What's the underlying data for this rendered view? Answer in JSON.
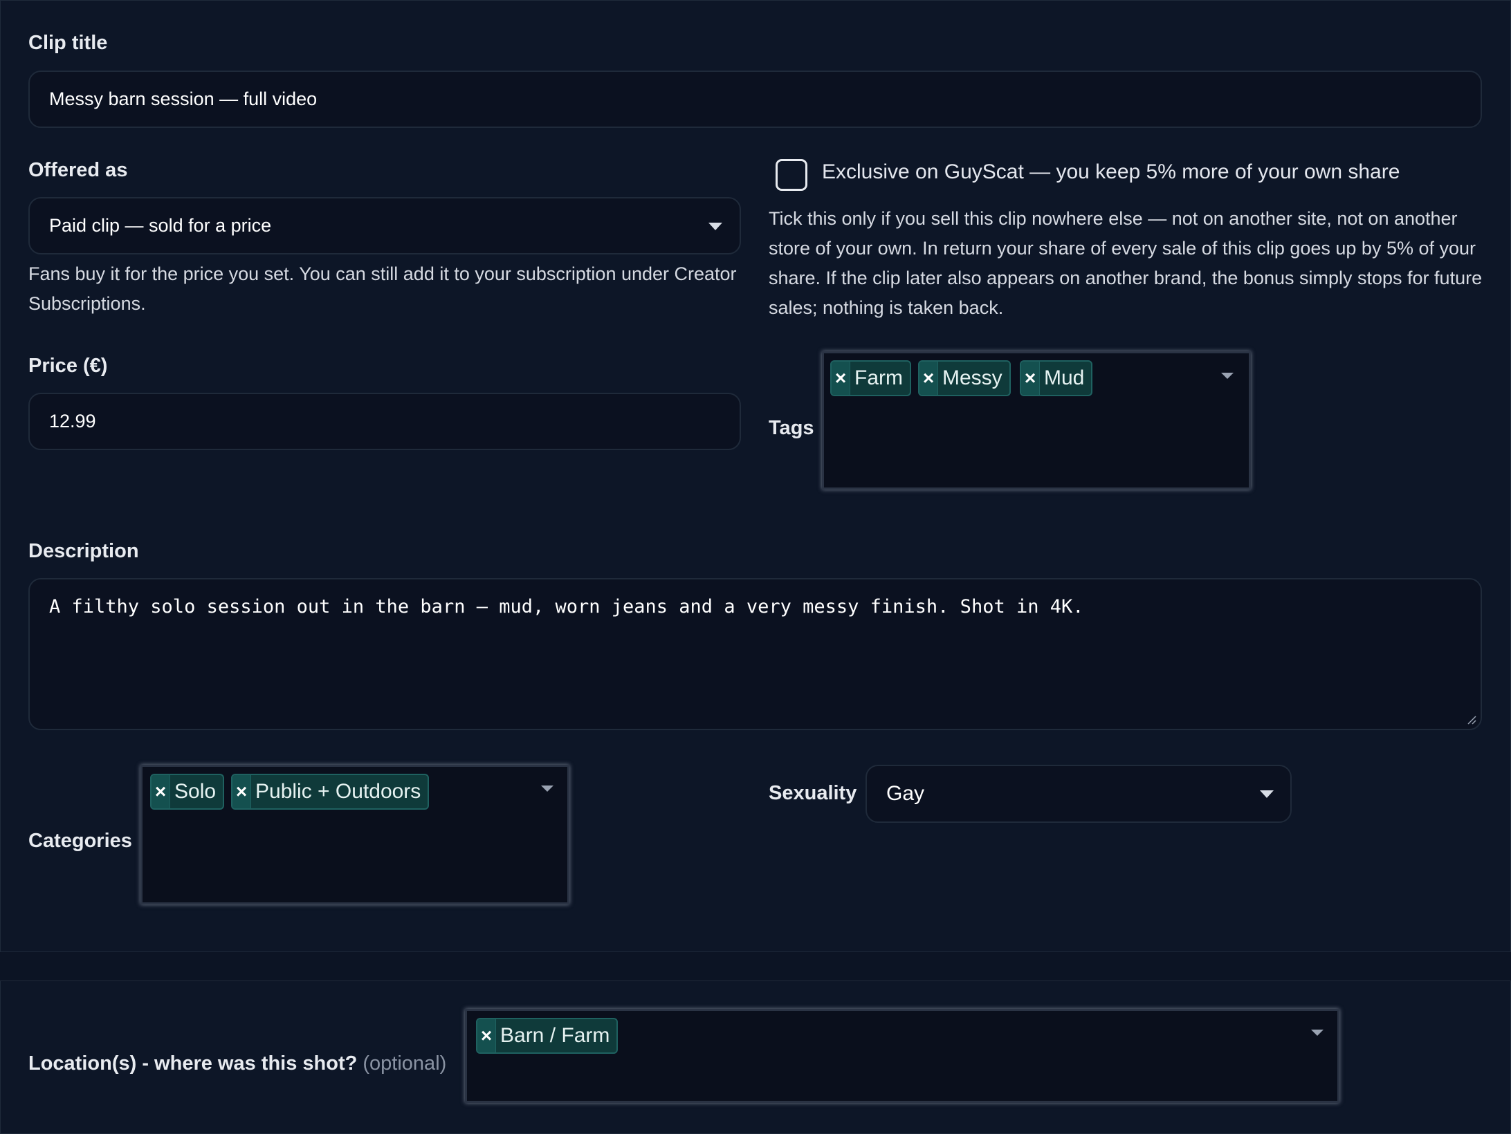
{
  "clip_title": {
    "label": "Clip title",
    "value": "Messy barn session — full video"
  },
  "offered_as": {
    "label": "Offered as",
    "value": "Paid clip — sold for a price",
    "help": "Fans buy it for the price you set. You can still add it to your subscription under Creator Subscriptions."
  },
  "exclusive": {
    "label": "Exclusive on GuyScat — you keep 5% more of your own share",
    "checked": false,
    "help": "Tick this only if you sell this clip nowhere else — not on another site, not on another store of your own. In return your share of every sale of this clip goes up by 5% of your share. If the clip later also appears on another brand, the bonus simply stops for future sales; nothing is taken back."
  },
  "price": {
    "label": "Price (€)",
    "value": "12.99"
  },
  "tags": {
    "label": "Tags",
    "items": [
      "Farm",
      "Messy",
      "Mud"
    ]
  },
  "description": {
    "label": "Description",
    "value": "A filthy solo session out in the barn — mud, worn jeans and a very messy finish. Shot in 4K."
  },
  "categories": {
    "label": "Categories",
    "items": [
      "Solo",
      "Public + Outdoors"
    ]
  },
  "sexuality": {
    "label": "Sexuality",
    "value": "Gay"
  },
  "location": {
    "label": "Location(s) - where was this shot?",
    "optional": "(optional)",
    "items": [
      "Barn / Farm"
    ]
  },
  "chip_remove_glyph": "×",
  "colors": {
    "background": "#0c1424",
    "chip": "#0f3a3a",
    "chip_border": "#1f6160",
    "input": "#0b1120"
  }
}
